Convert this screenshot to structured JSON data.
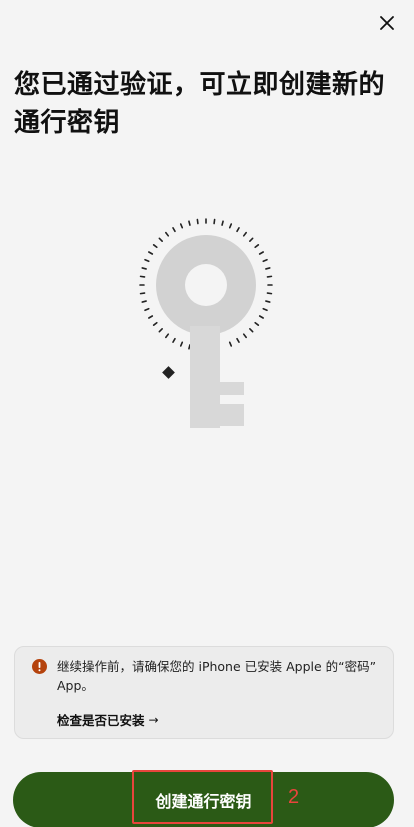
{
  "header": {
    "close_icon": "close-icon"
  },
  "title": "您已通过验证，可立即创建新的通行密钥",
  "illustration": {
    "icon": "key-icon"
  },
  "notice": {
    "icon": "warning-icon",
    "icon_color": "#b5430d",
    "text": "继续操作前，请确保您的 iPhone 已安装 Apple 的“密码” App。",
    "link_label": "检查是否已安装",
    "link_arrow": "→"
  },
  "primary_button": {
    "label": "创建通行密钥",
    "color": "#2b5a16"
  },
  "annotation": {
    "step": "2",
    "color": "#e8453c"
  }
}
